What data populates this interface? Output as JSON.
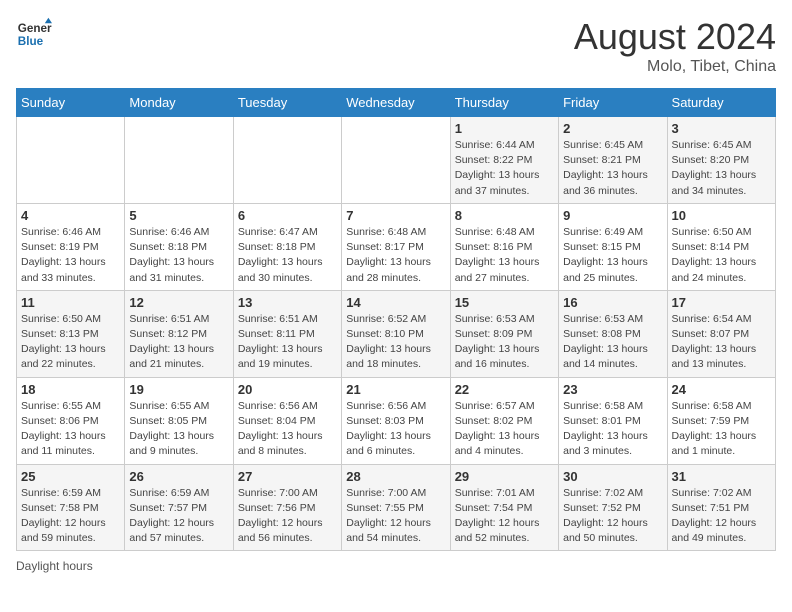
{
  "header": {
    "logo_line1": "General",
    "logo_line2": "Blue",
    "main_title": "August 2024",
    "subtitle": "Molo, Tibet, China"
  },
  "days_of_week": [
    "Sunday",
    "Monday",
    "Tuesday",
    "Wednesday",
    "Thursday",
    "Friday",
    "Saturday"
  ],
  "weeks": [
    [
      {
        "day": "",
        "info": ""
      },
      {
        "day": "",
        "info": ""
      },
      {
        "day": "",
        "info": ""
      },
      {
        "day": "",
        "info": ""
      },
      {
        "day": "1",
        "info": "Sunrise: 6:44 AM\nSunset: 8:22 PM\nDaylight: 13 hours and 37 minutes."
      },
      {
        "day": "2",
        "info": "Sunrise: 6:45 AM\nSunset: 8:21 PM\nDaylight: 13 hours and 36 minutes."
      },
      {
        "day": "3",
        "info": "Sunrise: 6:45 AM\nSunset: 8:20 PM\nDaylight: 13 hours and 34 minutes."
      }
    ],
    [
      {
        "day": "4",
        "info": "Sunrise: 6:46 AM\nSunset: 8:19 PM\nDaylight: 13 hours and 33 minutes."
      },
      {
        "day": "5",
        "info": "Sunrise: 6:46 AM\nSunset: 8:18 PM\nDaylight: 13 hours and 31 minutes."
      },
      {
        "day": "6",
        "info": "Sunrise: 6:47 AM\nSunset: 8:18 PM\nDaylight: 13 hours and 30 minutes."
      },
      {
        "day": "7",
        "info": "Sunrise: 6:48 AM\nSunset: 8:17 PM\nDaylight: 13 hours and 28 minutes."
      },
      {
        "day": "8",
        "info": "Sunrise: 6:48 AM\nSunset: 8:16 PM\nDaylight: 13 hours and 27 minutes."
      },
      {
        "day": "9",
        "info": "Sunrise: 6:49 AM\nSunset: 8:15 PM\nDaylight: 13 hours and 25 minutes."
      },
      {
        "day": "10",
        "info": "Sunrise: 6:50 AM\nSunset: 8:14 PM\nDaylight: 13 hours and 24 minutes."
      }
    ],
    [
      {
        "day": "11",
        "info": "Sunrise: 6:50 AM\nSunset: 8:13 PM\nDaylight: 13 hours and 22 minutes."
      },
      {
        "day": "12",
        "info": "Sunrise: 6:51 AM\nSunset: 8:12 PM\nDaylight: 13 hours and 21 minutes."
      },
      {
        "day": "13",
        "info": "Sunrise: 6:51 AM\nSunset: 8:11 PM\nDaylight: 13 hours and 19 minutes."
      },
      {
        "day": "14",
        "info": "Sunrise: 6:52 AM\nSunset: 8:10 PM\nDaylight: 13 hours and 18 minutes."
      },
      {
        "day": "15",
        "info": "Sunrise: 6:53 AM\nSunset: 8:09 PM\nDaylight: 13 hours and 16 minutes."
      },
      {
        "day": "16",
        "info": "Sunrise: 6:53 AM\nSunset: 8:08 PM\nDaylight: 13 hours and 14 minutes."
      },
      {
        "day": "17",
        "info": "Sunrise: 6:54 AM\nSunset: 8:07 PM\nDaylight: 13 hours and 13 minutes."
      }
    ],
    [
      {
        "day": "18",
        "info": "Sunrise: 6:55 AM\nSunset: 8:06 PM\nDaylight: 13 hours and 11 minutes."
      },
      {
        "day": "19",
        "info": "Sunrise: 6:55 AM\nSunset: 8:05 PM\nDaylight: 13 hours and 9 minutes."
      },
      {
        "day": "20",
        "info": "Sunrise: 6:56 AM\nSunset: 8:04 PM\nDaylight: 13 hours and 8 minutes."
      },
      {
        "day": "21",
        "info": "Sunrise: 6:56 AM\nSunset: 8:03 PM\nDaylight: 13 hours and 6 minutes."
      },
      {
        "day": "22",
        "info": "Sunrise: 6:57 AM\nSunset: 8:02 PM\nDaylight: 13 hours and 4 minutes."
      },
      {
        "day": "23",
        "info": "Sunrise: 6:58 AM\nSunset: 8:01 PM\nDaylight: 13 hours and 3 minutes."
      },
      {
        "day": "24",
        "info": "Sunrise: 6:58 AM\nSunset: 7:59 PM\nDaylight: 13 hours and 1 minute."
      }
    ],
    [
      {
        "day": "25",
        "info": "Sunrise: 6:59 AM\nSunset: 7:58 PM\nDaylight: 12 hours and 59 minutes."
      },
      {
        "day": "26",
        "info": "Sunrise: 6:59 AM\nSunset: 7:57 PM\nDaylight: 12 hours and 57 minutes."
      },
      {
        "day": "27",
        "info": "Sunrise: 7:00 AM\nSunset: 7:56 PM\nDaylight: 12 hours and 56 minutes."
      },
      {
        "day": "28",
        "info": "Sunrise: 7:00 AM\nSunset: 7:55 PM\nDaylight: 12 hours and 54 minutes."
      },
      {
        "day": "29",
        "info": "Sunrise: 7:01 AM\nSunset: 7:54 PM\nDaylight: 12 hours and 52 minutes."
      },
      {
        "day": "30",
        "info": "Sunrise: 7:02 AM\nSunset: 7:52 PM\nDaylight: 12 hours and 50 minutes."
      },
      {
        "day": "31",
        "info": "Sunrise: 7:02 AM\nSunset: 7:51 PM\nDaylight: 12 hours and 49 minutes."
      }
    ]
  ],
  "footer": {
    "label": "Daylight hours"
  }
}
